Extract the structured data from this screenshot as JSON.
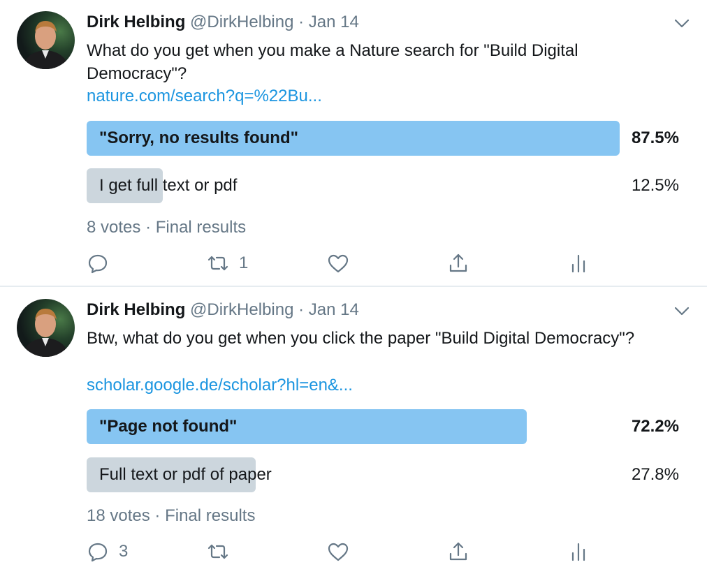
{
  "tweets": [
    {
      "author": {
        "name": "Dirk Helbing",
        "handle": "@DirkHelbing",
        "date": "Jan 14"
      },
      "text": "What do you get when you make a Nature search for \"Build Digital Democracy\"?",
      "link": "nature.com/search?q=%22Bu...",
      "poll": {
        "options": [
          {
            "label": "\"Sorry, no results found\"",
            "percent": "87.5%",
            "fraction": 0.875,
            "winner": true
          },
          {
            "label": "I get full text or pdf",
            "percent": "12.5%",
            "fraction": 0.125,
            "winner": false
          }
        ],
        "votes": "8 votes",
        "status": "Final results"
      },
      "actions": {
        "reply_count": "",
        "retweet_count": "1",
        "like_count": ""
      }
    },
    {
      "author": {
        "name": "Dirk Helbing",
        "handle": "@DirkHelbing",
        "date": "Jan 14"
      },
      "text": "Btw, what do you get when you click the paper \"Build Digital Democracy\"?",
      "link": "scholar.google.de/scholar?hl=en&...",
      "poll": {
        "options": [
          {
            "label": "\"Page not found\"",
            "percent": "72.2%",
            "fraction": 0.722,
            "winner": true
          },
          {
            "label": "Full text or pdf of paper",
            "percent": "27.8%",
            "fraction": 0.278,
            "winner": false
          }
        ],
        "votes": "18 votes",
        "status": "Final results"
      },
      "actions": {
        "reply_count": "3",
        "retweet_count": "",
        "like_count": ""
      }
    }
  ],
  "separator": "·",
  "icons": [
    "reply-icon",
    "retweet-icon",
    "like-icon",
    "share-icon",
    "analytics-icon",
    "chevron-down-icon"
  ],
  "colors": {
    "winner_bar": "#86c5f2",
    "loser_bar": "#ccd6dd",
    "link": "#1b95e0",
    "secondary": "#657786"
  }
}
